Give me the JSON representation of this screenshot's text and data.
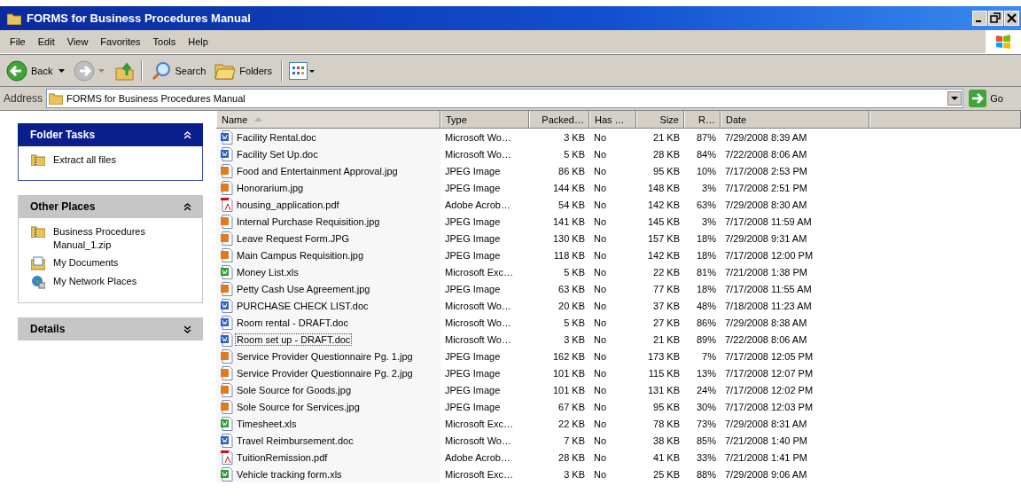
{
  "window": {
    "title": "FORMS for Business Procedures Manual"
  },
  "menu": [
    "File",
    "Edit",
    "View",
    "Favorites",
    "Tools",
    "Help"
  ],
  "toolbar": {
    "back": "Back",
    "search": "Search",
    "folders": "Folders"
  },
  "address": {
    "label": "Address",
    "value": "FORMS for Business Procedures Manual",
    "go": "Go"
  },
  "sidebar": {
    "panels": [
      {
        "title": "Folder Tasks",
        "kind": "special",
        "expanded": true,
        "items": [
          {
            "label": "Extract all files",
            "kind": "zip"
          }
        ]
      },
      {
        "title": "Other Places",
        "kind": "normal",
        "expanded": true,
        "items": [
          {
            "label": "Business Procedures Manual_1.zip",
            "kind": "zip"
          },
          {
            "label": "My Documents",
            "kind": "documents"
          },
          {
            "label": "My Network Places",
            "kind": "network"
          }
        ]
      },
      {
        "title": "Details",
        "kind": "normal",
        "expanded": false
      }
    ]
  },
  "table": {
    "columns": [
      {
        "label": "Name",
        "kind": "text",
        "sorted": true
      },
      {
        "label": "Type",
        "kind": "text",
        "sorted": false
      },
      {
        "label": "Packed…",
        "kind": "number",
        "sorted": false
      },
      {
        "label": "Has …",
        "kind": "text",
        "sorted": false
      },
      {
        "label": "Size",
        "kind": "number",
        "sorted": false
      },
      {
        "label": "R…",
        "kind": "number",
        "sorted": false
      },
      {
        "label": "Date",
        "kind": "text",
        "sorted": false
      }
    ],
    "rows": [
      {
        "kind": "word",
        "focused": false,
        "cells": [
          "Facility Rental.doc",
          "Microsoft Wo…",
          "3 KB",
          "No",
          "21 KB",
          "87%",
          "7/29/2008 8:39 AM"
        ]
      },
      {
        "kind": "word",
        "focused": false,
        "cells": [
          "Facility Set Up.doc",
          "Microsoft Wo…",
          "5 KB",
          "No",
          "28 KB",
          "84%",
          "7/22/2008 8:06 AM"
        ]
      },
      {
        "kind": "jpeg",
        "focused": false,
        "cells": [
          "Food and Entertainment Approval.jpg",
          "JPEG Image",
          "86 KB",
          "No",
          "95 KB",
          "10%",
          "7/17/2008 2:53 PM"
        ]
      },
      {
        "kind": "jpeg",
        "focused": false,
        "cells": [
          "Honorarium.jpg",
          "JPEG Image",
          "144 KB",
          "No",
          "148 KB",
          "3%",
          "7/17/2008 2:51 PM"
        ]
      },
      {
        "kind": "pdf",
        "focused": false,
        "cells": [
          "housing_application.pdf",
          "Adobe Acrob…",
          "54 KB",
          "No",
          "142 KB",
          "63%",
          "7/29/2008 8:30 AM"
        ]
      },
      {
        "kind": "jpeg",
        "focused": false,
        "cells": [
          "Internal Purchase Requisition.jpg",
          "JPEG Image",
          "141 KB",
          "No",
          "145 KB",
          "3%",
          "7/17/2008 11:59 AM"
        ]
      },
      {
        "kind": "jpeg",
        "focused": false,
        "cells": [
          "Leave Request Form.JPG",
          "JPEG Image",
          "130 KB",
          "No",
          "157 KB",
          "18%",
          "7/29/2008 9:31 AM"
        ]
      },
      {
        "kind": "jpeg",
        "focused": false,
        "cells": [
          "Main Campus Requisition.jpg",
          "JPEG Image",
          "118 KB",
          "No",
          "142 KB",
          "18%",
          "7/17/2008 12:00 PM"
        ]
      },
      {
        "kind": "excel",
        "focused": false,
        "cells": [
          "Money List.xls",
          "Microsoft Exc…",
          "5 KB",
          "No",
          "22 KB",
          "81%",
          "7/21/2008 1:38 PM"
        ]
      },
      {
        "kind": "jpeg",
        "focused": false,
        "cells": [
          "Petty Cash Use Agreement.jpg",
          "JPEG Image",
          "63 KB",
          "No",
          "77 KB",
          "18%",
          "7/17/2008 11:55 AM"
        ]
      },
      {
        "kind": "word",
        "focused": false,
        "cells": [
          "PURCHASE CHECK LIST.doc",
          "Microsoft Wo…",
          "20 KB",
          "No",
          "37 KB",
          "48%",
          "7/18/2008 11:23 AM"
        ]
      },
      {
        "kind": "word",
        "focused": false,
        "cells": [
          "Room rental - DRAFT.doc",
          "Microsoft Wo…",
          "5 KB",
          "No",
          "27 KB",
          "86%",
          "7/29/2008 8:38 AM"
        ]
      },
      {
        "kind": "word",
        "focused": true,
        "cells": [
          "Room set up - DRAFT.doc",
          "Microsoft Wo…",
          "3 KB",
          "No",
          "21 KB",
          "89%",
          "7/22/2008 8:06 AM"
        ]
      },
      {
        "kind": "jpeg",
        "focused": false,
        "cells": [
          "Service Provider Questionnaire Pg. 1.jpg",
          "JPEG Image",
          "162 KB",
          "No",
          "173 KB",
          "7%",
          "7/17/2008 12:05 PM"
        ]
      },
      {
        "kind": "jpeg",
        "focused": false,
        "cells": [
          "Service Provider Questionnaire Pg. 2.jpg",
          "JPEG Image",
          "101 KB",
          "No",
          "115 KB",
          "13%",
          "7/17/2008 12:07 PM"
        ]
      },
      {
        "kind": "jpeg",
        "focused": false,
        "cells": [
          "Sole Source for Goods.jpg",
          "JPEG Image",
          "101 KB",
          "No",
          "131 KB",
          "24%",
          "7/17/2008 12:02 PM"
        ]
      },
      {
        "kind": "jpeg",
        "focused": false,
        "cells": [
          "Sole Source for Services.jpg",
          "JPEG Image",
          "67 KB",
          "No",
          "95 KB",
          "30%",
          "7/17/2008 12:03 PM"
        ]
      },
      {
        "kind": "excel",
        "focused": false,
        "cells": [
          "Timesheet.xls",
          "Microsoft Exc…",
          "22 KB",
          "No",
          "78 KB",
          "73%",
          "7/29/2008 8:31 AM"
        ]
      },
      {
        "kind": "word",
        "focused": false,
        "cells": [
          "Travel Reimbursement.doc",
          "Microsoft Wo…",
          "7 KB",
          "No",
          "38 KB",
          "85%",
          "7/21/2008 1:40 PM"
        ]
      },
      {
        "kind": "pdf",
        "focused": false,
        "cells": [
          "TuitionRemission.pdf",
          "Adobe Acrob…",
          "28 KB",
          "No",
          "41 KB",
          "33%",
          "7/21/2008 1:41 PM"
        ]
      },
      {
        "kind": "excel",
        "focused": false,
        "cells": [
          "Vehicle tracking form.xls",
          "Microsoft Exc…",
          "3 KB",
          "No",
          "25 KB",
          "88%",
          "7/29/2008 9:06 AM"
        ]
      }
    ]
  }
}
